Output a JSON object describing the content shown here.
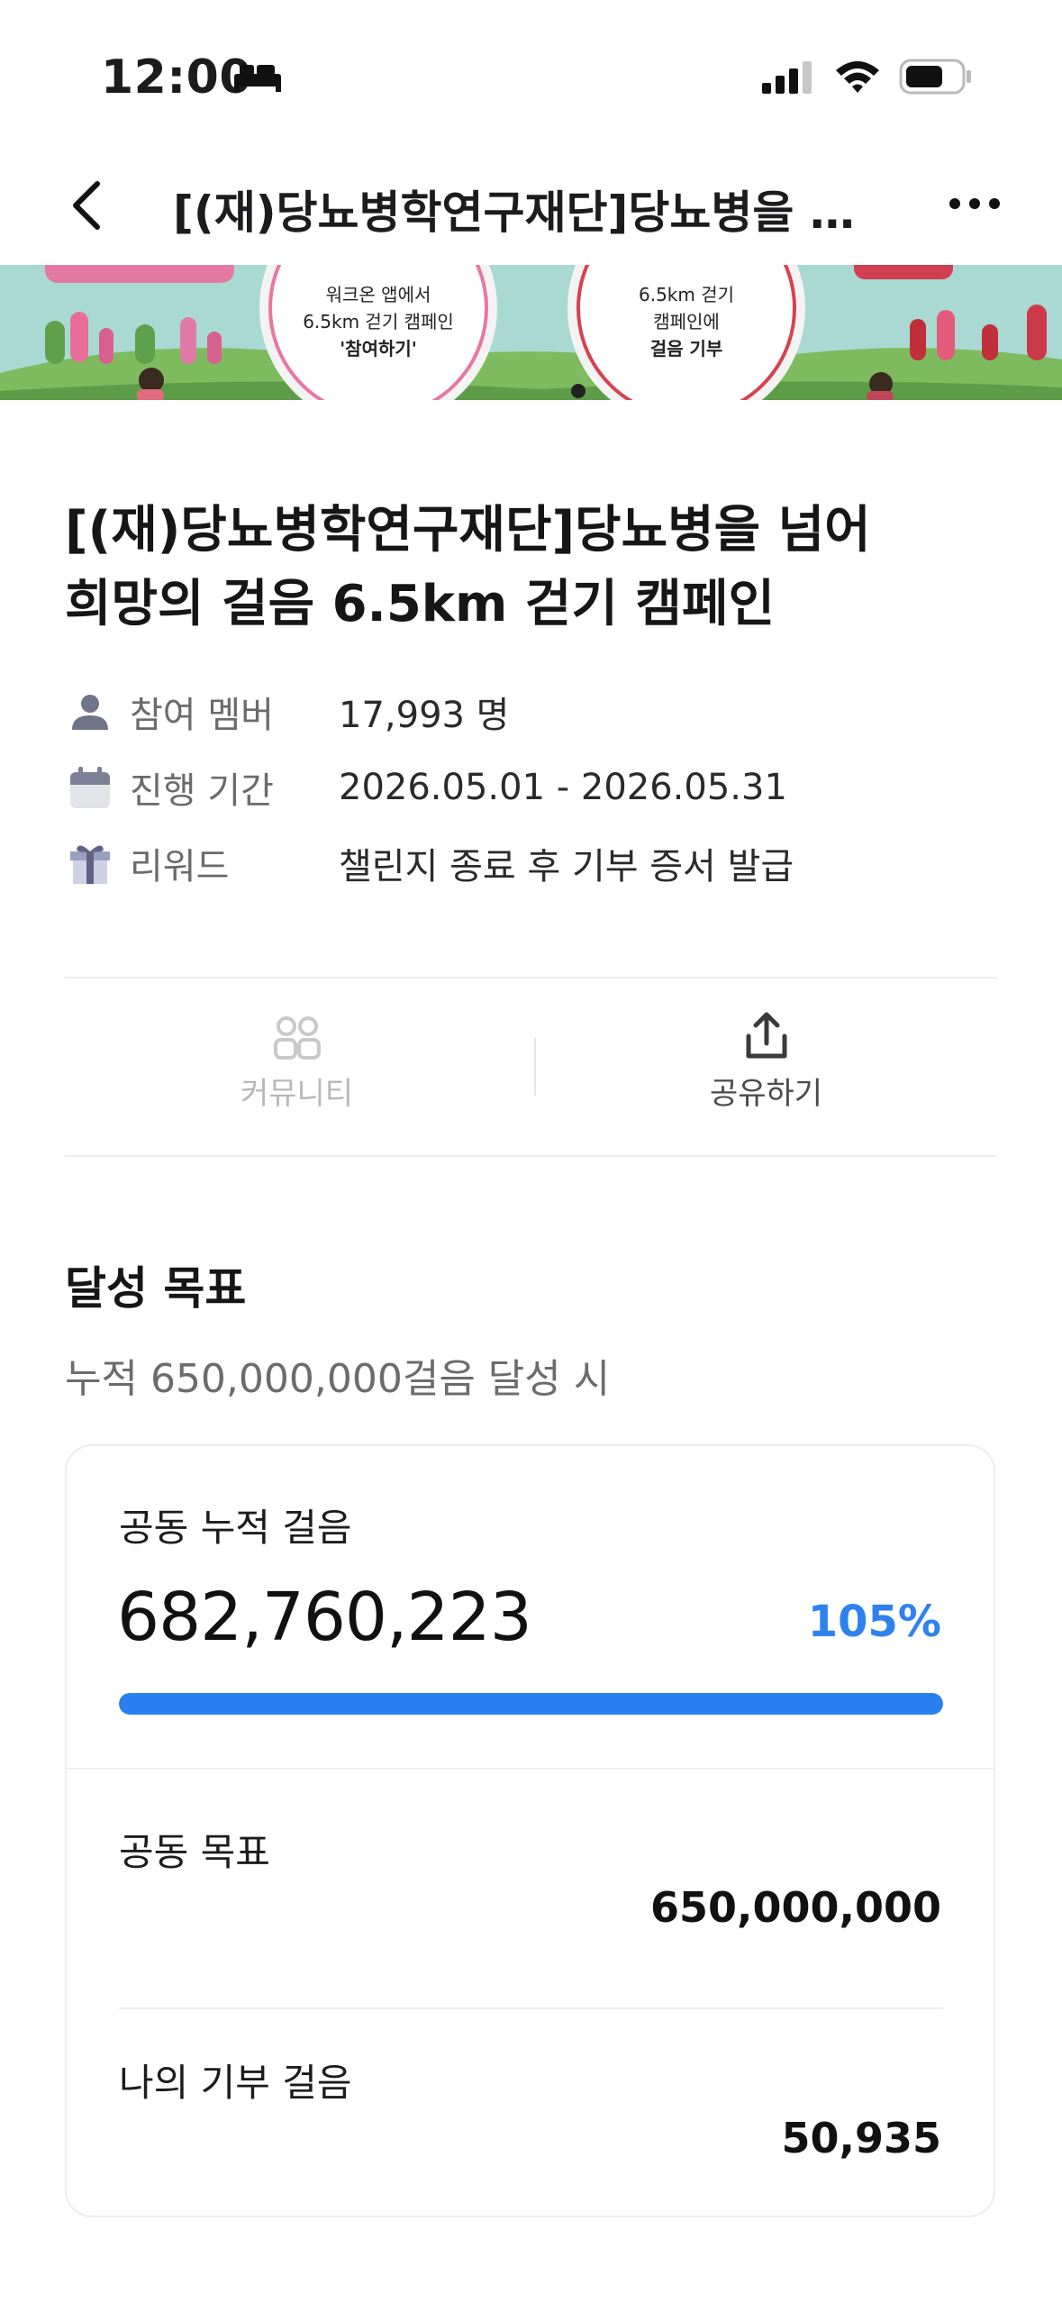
{
  "status_bar": {
    "time": "12:00"
  },
  "nav": {
    "title": "[(재)당뇨병학연구재단]당뇨병을 넘어 희망의 걸음 6.5km 걷기 캠페인"
  },
  "banner": {
    "left_circle": [
      "워크온 앱에서",
      "6.5km 걷기 캠페인",
      "'참여하기'"
    ],
    "right_circle": [
      "6.5km 걷기",
      "캠페인에",
      "걸음 기부"
    ]
  },
  "campaign": {
    "title_line1": "[(재)당뇨병학연구재단]당뇨병을 넘어",
    "title_line2": "희망의 걸음 6.5km 걷기 캠페인",
    "info": [
      {
        "label": "참여 멤버",
        "value": "17,993 명",
        "icon": "person-icon"
      },
      {
        "label": "진행 기간",
        "value": "2026.05.01 - 2026.05.31",
        "icon": "calendar-icon"
      },
      {
        "label": "리워드",
        "value": "챌린지 종료 후 기부 증서 발급",
        "icon": "gift-icon"
      }
    ]
  },
  "actions": {
    "community": "커뮤니티",
    "share": "공유하기"
  },
  "goal": {
    "section_title": "달성 목표",
    "subtitle": "누적 650,000,000걸음 달성 시",
    "cumulative_label": "공동 누적 걸음",
    "cumulative_value": "682,760,223",
    "percent": "105%",
    "progress_fraction": 1.0,
    "target_label": "공동 목표",
    "target_value": "650,000,000",
    "my_label": "나의 기부 걸음",
    "my_value": "50,935"
  },
  "colors": {
    "accent": "#2f82ee",
    "progress": "#2a7ff0",
    "banner_bg": "#9bd0c9"
  }
}
